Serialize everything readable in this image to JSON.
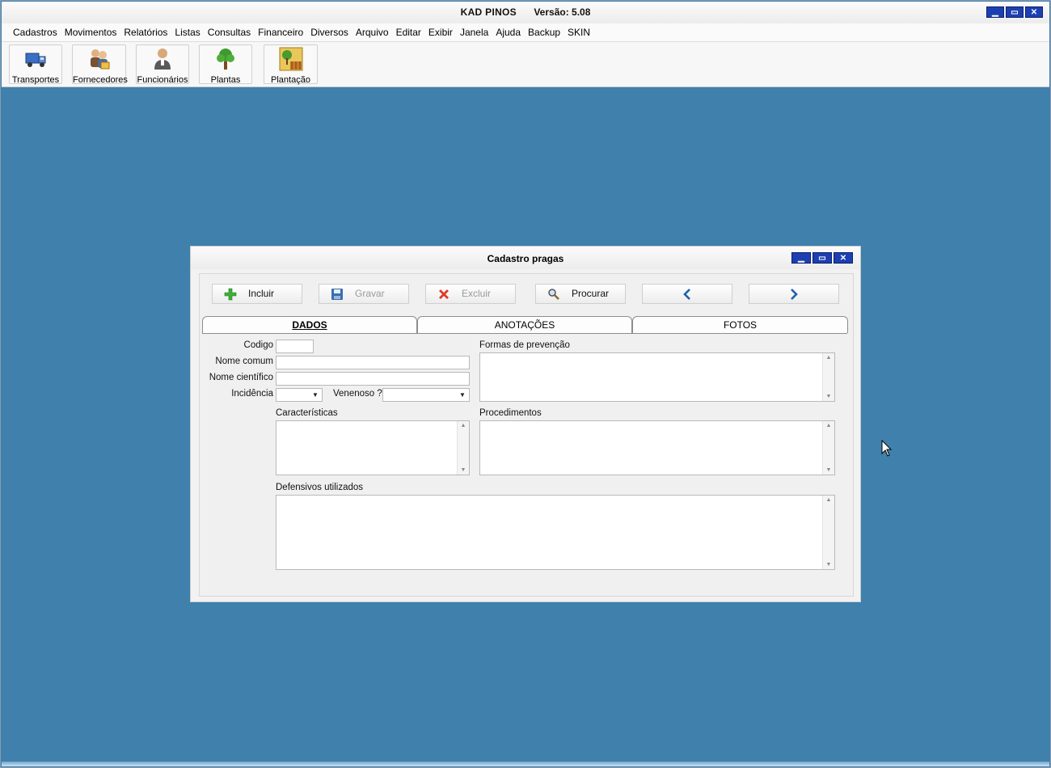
{
  "app": {
    "title": "KAD PINOS",
    "version": "Versão: 5.08"
  },
  "window_buttons": {
    "minimize": "▁",
    "maximize": "▭",
    "close": "✕"
  },
  "menu": [
    "Cadastros",
    "Movimentos",
    "Relatórios",
    "Listas",
    "Consultas",
    "Financeiro",
    "Diversos",
    "Arquivo",
    "Editar",
    "Exibir",
    "Janela",
    "Ajuda",
    "Backup",
    "SKIN"
  ],
  "toolbar": [
    {
      "label": "Transportes",
      "icon": "truck-icon"
    },
    {
      "label": "Fornecedores",
      "icon": "suppliers-icon"
    },
    {
      "label": "Funcionários",
      "icon": "employee-icon"
    },
    {
      "label": "Plantas",
      "icon": "tree-icon"
    },
    {
      "label": "Plantação",
      "icon": "plantation-icon"
    }
  ],
  "child": {
    "title": "Cadastro pragas",
    "actions": {
      "incluir": "Incluir",
      "gravar": "Gravar",
      "excluir": "Excluir",
      "procurar": "Procurar"
    },
    "tabs": [
      "DADOS",
      "ANOTAÇÕES",
      "FOTOS"
    ],
    "active_tab": "DADOS",
    "form": {
      "codigo_label": "Codigo",
      "codigo_value": "",
      "nome_comum_label": "Nome comum",
      "nome_comum_value": "",
      "nome_cientifico_label": "Nome científico",
      "nome_cientifico_value": "",
      "incidencia_label": "Incidência",
      "incidencia_value": "",
      "venenoso_label": "Venenoso ?",
      "venenoso_value": "",
      "caracteristicas_label": "Características",
      "formas_prevencao_label": "Formas de prevenção",
      "procedimentos_label": "Procedimentos",
      "defensivos_label": "Defensivos utilizados"
    }
  },
  "colors": {
    "desktop": "#3f80ac",
    "title_button": "#1c3fb2",
    "disabled_text": "#9a9a9a"
  }
}
